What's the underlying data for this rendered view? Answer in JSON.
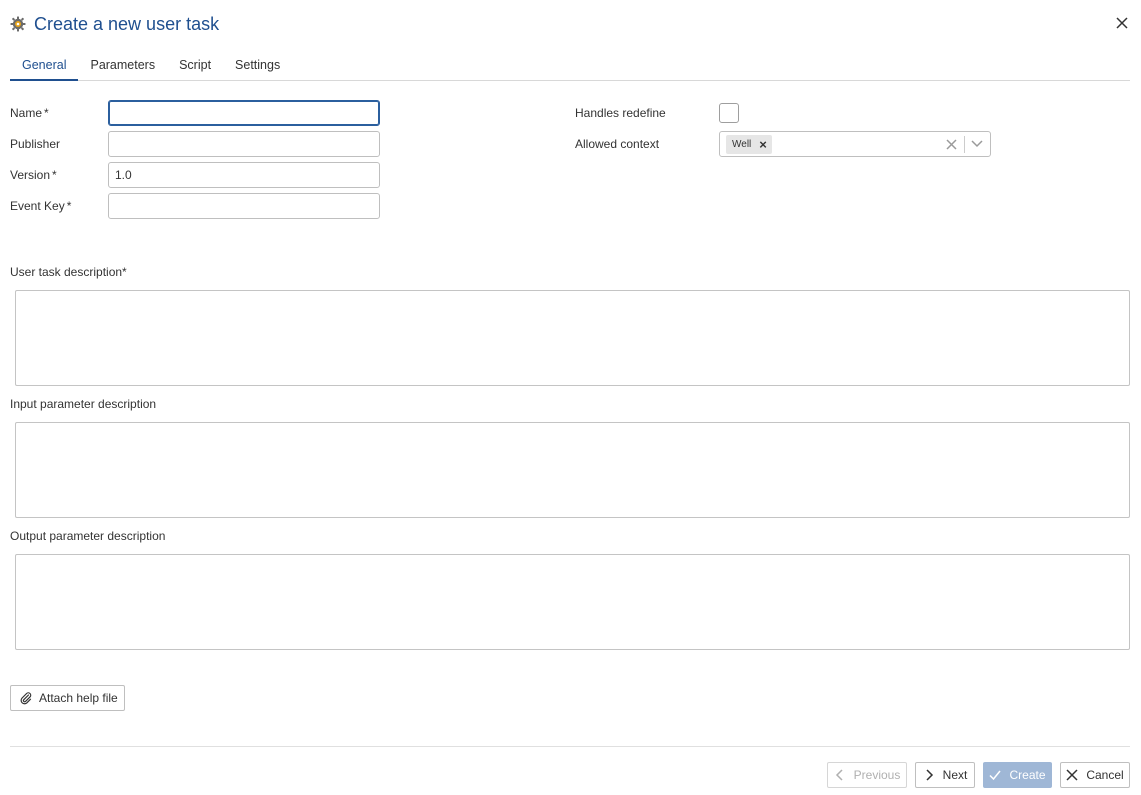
{
  "dialog": {
    "title": "Create a new user task",
    "title_icon": "gear-icon",
    "close_icon": "close-icon"
  },
  "tabs": [
    {
      "label": "General",
      "active": true
    },
    {
      "label": "Parameters",
      "active": false
    },
    {
      "label": "Script",
      "active": false
    },
    {
      "label": "Settings",
      "active": false
    }
  ],
  "form": {
    "name": {
      "label": "Name",
      "required_mark": "*",
      "value": ""
    },
    "publisher": {
      "label": "Publisher",
      "value": ""
    },
    "version": {
      "label": "Version",
      "required_mark": "*",
      "value": "1.0"
    },
    "event_key": {
      "label": "Event Key",
      "required_mark": "*",
      "value": ""
    },
    "handles_redefine": {
      "label": "Handles redefine",
      "checked": false
    },
    "allowed_context": {
      "label": "Allowed context",
      "selected": [
        "Well"
      ]
    }
  },
  "descriptions": {
    "user_task": {
      "label": "User task description",
      "required_mark": "*",
      "value": ""
    },
    "input_param": {
      "label": "Input parameter description",
      "value": ""
    },
    "output_param": {
      "label": "Output parameter description",
      "value": ""
    }
  },
  "attach": {
    "label": "Attach help file",
    "icon": "paperclip-icon"
  },
  "footer": {
    "previous_label": "Previous",
    "next_label": "Next",
    "create_label": "Create",
    "cancel_label": "Cancel"
  },
  "colors": {
    "accent": "#1f4f8f",
    "create_disabled": "#9fb7d6"
  }
}
